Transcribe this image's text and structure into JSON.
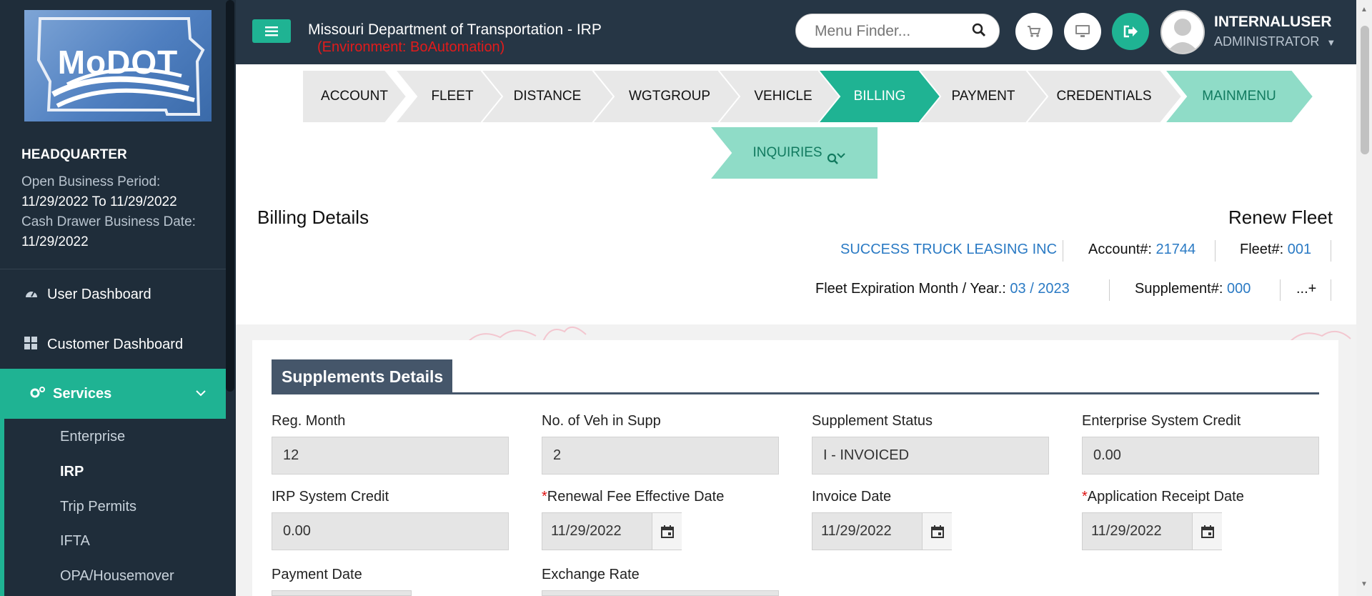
{
  "sidebar": {
    "logo_text": "MoDOT",
    "location": "HEADQUARTER",
    "open_business_period_label": "Open Business Period:",
    "open_business_period_value": "11/29/2022 To 11/29/2022",
    "cash_drawer_label": "Cash Drawer Business Date:",
    "cash_drawer_value": "11/29/2022",
    "nav": {
      "user_dashboard": "User Dashboard",
      "customer_dashboard": "Customer Dashboard",
      "services": "Services"
    },
    "submenu": [
      "Enterprise",
      "IRP",
      "Trip Permits",
      "IFTA",
      "OPA/Housemover"
    ],
    "active_submenu": "IRP"
  },
  "header": {
    "title": "Missouri Department of Transportation - IRP",
    "environment": "(Environment: BoAutomation)",
    "menu_finder_placeholder": "Menu Finder...",
    "user_name": "INTERNALUSER",
    "user_role": "ADMINISTRATOR"
  },
  "wizard": {
    "steps": [
      "ACCOUNT",
      "FLEET",
      "DISTANCE",
      "WGTGROUP",
      "VEHICLE",
      "BILLING",
      "PAYMENT",
      "CREDENTIALS",
      "MAINMENU"
    ],
    "active_step": "BILLING",
    "inquiries_label": "INQUIRIES"
  },
  "page": {
    "title": "Billing Details",
    "transaction": "Renew Fleet",
    "company_name": "SUCCESS TRUCK LEASING INC",
    "account_label": "Account#:",
    "account_value": "21744",
    "fleet_label": "Fleet#:",
    "fleet_value": "001",
    "expiration_label": "Fleet Expiration Month / Year.:",
    "expiration_value": "03 / 2023",
    "supplement_label": "Supplement#:",
    "supplement_value": "000",
    "more_label": "...+"
  },
  "supplements": {
    "section_title": "Supplements Details",
    "reg_month_label": "Reg. Month",
    "reg_month_value": "12",
    "veh_in_supp_label": "No. of Veh in Supp",
    "veh_in_supp_value": "2",
    "supp_status_label": "Supplement Status",
    "supp_status_value": "I - INVOICED",
    "enterprise_credit_label": "Enterprise System Credit",
    "enterprise_credit_value": "0.00",
    "irp_credit_label": "IRP System Credit",
    "irp_credit_value": "0.00",
    "renewal_fee_label": "Renewal Fee Effective Date",
    "renewal_fee_value": "11/29/2022",
    "invoice_date_label": "Invoice Date",
    "invoice_date_value": "11/29/2022",
    "app_receipt_label": "Application Receipt Date",
    "app_receipt_value": "11/29/2022",
    "payment_date_label": "Payment Date",
    "exchange_rate_label": "Exchange Rate",
    "required_marker": "*"
  },
  "colors": {
    "accent": "#1fb393",
    "sidebar_bg": "#1f2d3a",
    "header_bg": "#263645",
    "link": "#2a7ac4",
    "env_red": "#e21b1b"
  }
}
